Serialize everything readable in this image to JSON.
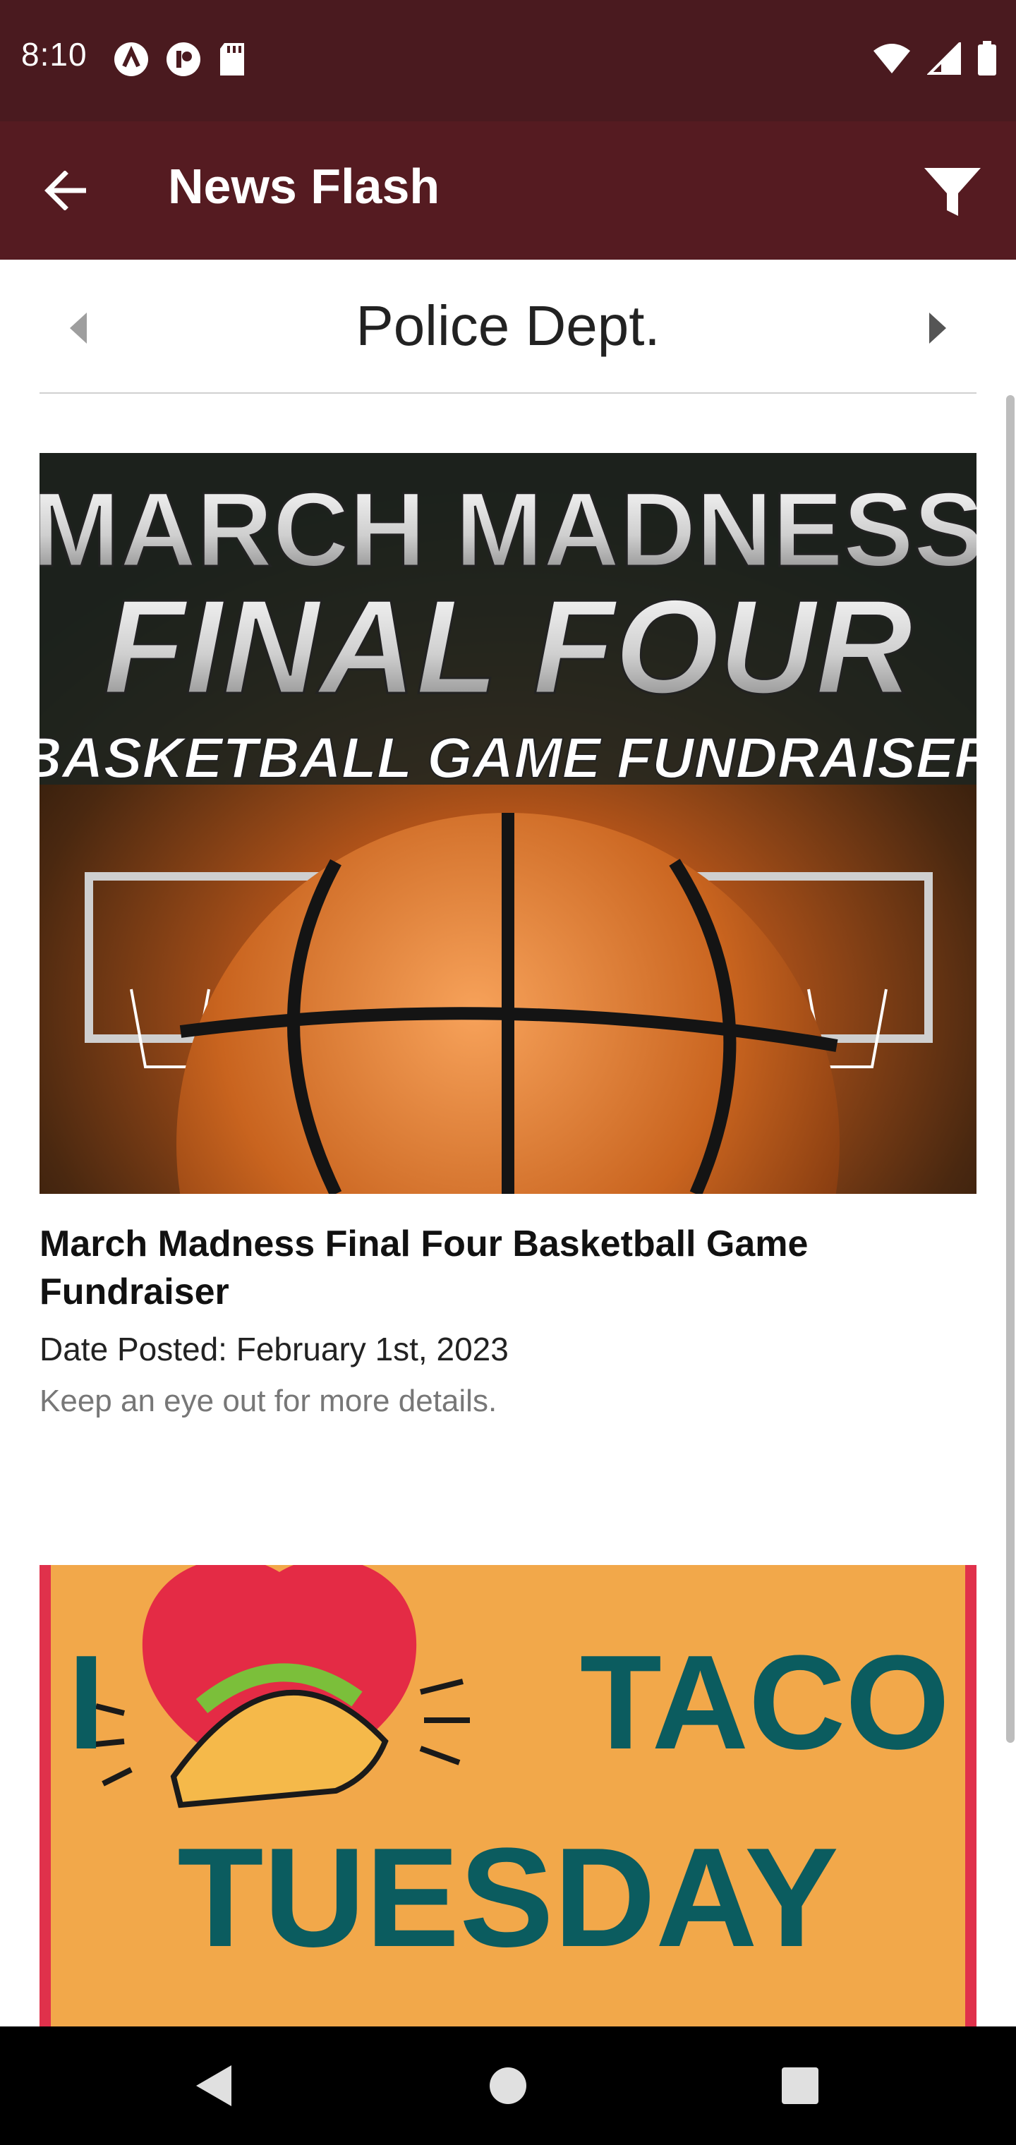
{
  "status_bar": {
    "time": "8:10",
    "left_icons": [
      "app-icon-a",
      "app-icon-b",
      "sd-card-icon"
    ],
    "right_icons": [
      "wifi-icon",
      "signal-icon",
      "battery-icon"
    ]
  },
  "app_bar": {
    "title": "News Flash",
    "back_icon": "back-arrow-icon",
    "filter_icon": "filter-icon",
    "background": "#551b21"
  },
  "category": {
    "name": "Police Dept.",
    "prev_icon": "chevron-left-icon",
    "next_icon": "chevron-right-icon"
  },
  "news": [
    {
      "image": {
        "line1": "MARCH MADNESS",
        "line2": "FINAL FOUR",
        "line3": "BASKETBALL GAME FUNDRAISER"
      },
      "title": "March Madness Final Four Basketball Game Fundraiser",
      "date": "Date Posted: February 1st, 2023",
      "summary": "Keep an eye out for more details."
    },
    {
      "image": {
        "line1a": "I",
        "line1b": "TACO",
        "line2": "TUESDAY"
      }
    }
  ],
  "nav_bar": {
    "icons": [
      "nav-back-icon",
      "nav-home-icon",
      "nav-recents-icon"
    ]
  }
}
